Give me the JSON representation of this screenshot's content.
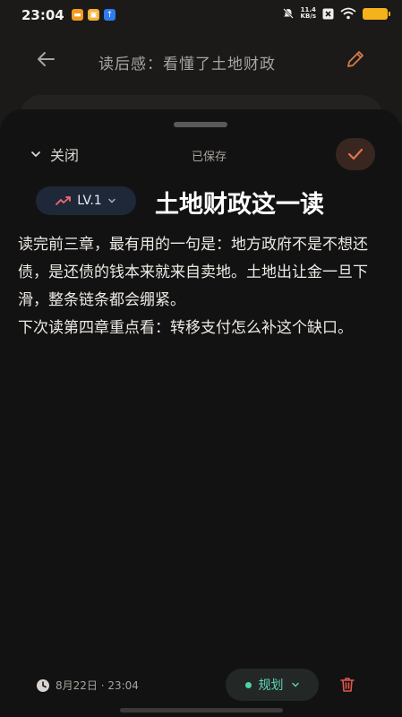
{
  "status_bar": {
    "time": "23:04",
    "net_speed_value": "11.4",
    "net_speed_unit": "KB/s",
    "icons": [
      "app-notification-icon",
      "app-notification-icon",
      "upload-icon",
      "mute-icon",
      "network-x-icon",
      "wifi-icon",
      "battery-icon"
    ],
    "battery_color": "#f6b21a"
  },
  "top_bar": {
    "title": "读后感：看懂了土地财政",
    "back_icon": "arrow-left-icon",
    "edit_icon": "pencil-icon",
    "edit_color": "#d97a4a"
  },
  "sheet": {
    "close_label": "关闭",
    "saved_label": "已保存",
    "confirm_icon": "check-icon",
    "accent_color": "#e0744a"
  },
  "note": {
    "level_label": "LV.1",
    "level_icon": "trending-up-icon",
    "title": "土地财政这一读",
    "body": "读完前三章，最有用的一句是：地方政府不是不想还债，是还债的钱本来就来自卖地。土地出让金一旦下滑，整条链条都会绷紧。\n下次读第四章重点看：转移支付怎么补这个缺口。"
  },
  "footer": {
    "date_text": "8月22日 · 23:04",
    "clock_icon": "clock-icon",
    "category_label": "规划",
    "category_color": "#4fd2a6",
    "delete_icon": "trash-icon",
    "delete_color": "#e2574c"
  }
}
